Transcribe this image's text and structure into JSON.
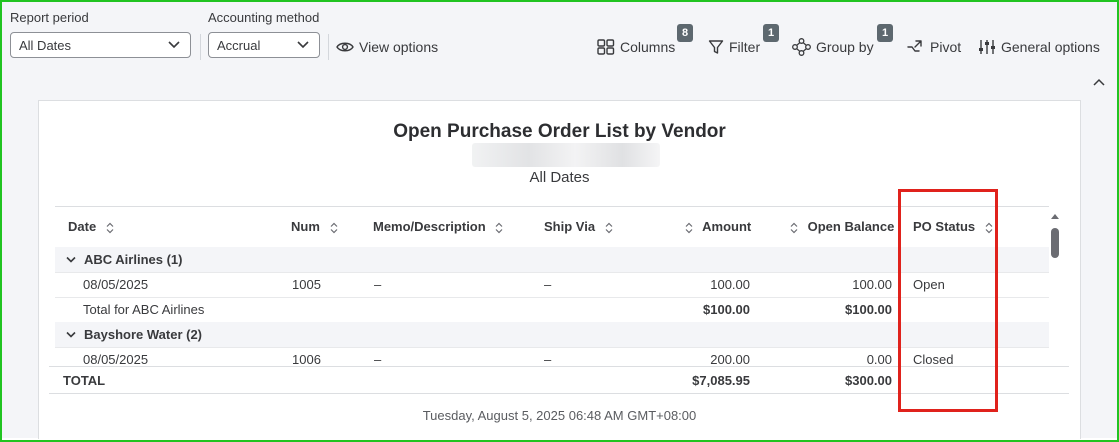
{
  "toolbar": {
    "report_period_label": "Report period",
    "report_period_value": "All Dates",
    "accounting_method_label": "Accounting method",
    "accounting_method_value": "Accrual",
    "view_options": "View options",
    "columns_label": "Columns",
    "columns_count": "8",
    "filter_label": "Filter",
    "filter_count": "1",
    "group_by_label": "Group by",
    "group_by_count": "1",
    "pivot_label": "Pivot",
    "general_options_label": "General options"
  },
  "report": {
    "title": "Open Purchase Order List by Vendor",
    "subtitle": "All Dates",
    "columns": [
      "Date",
      "Num",
      "Memo/Description",
      "Ship Via",
      "Amount",
      "Open Balance",
      "PO Status"
    ],
    "groups": [
      {
        "name": "ABC Airlines (1)",
        "rows": [
          {
            "date": "08/05/2025",
            "num": "1005",
            "memo": "–",
            "ship_via": "–",
            "amount": "100.00",
            "open_balance": "100.00",
            "status": "Open"
          }
        ],
        "total_label": "Total for ABC Airlines",
        "total_amount": "$100.00",
        "total_open_balance": "$100.00"
      },
      {
        "name": "Bayshore Water (2)",
        "rows": [
          {
            "date": "08/05/2025",
            "num": "1006",
            "memo": "–",
            "ship_via": "–",
            "amount": "200.00",
            "open_balance": "0.00",
            "status": "Closed"
          }
        ]
      }
    ],
    "total_label": "TOTAL",
    "total_amount": "$7,085.95",
    "total_open_balance": "$300.00",
    "footer": "Tuesday, August 5, 2025 06:48 AM GMT+08:00"
  },
  "colors": {
    "frame": "#21c421",
    "highlight": "#e0221c",
    "toolbar_bg": "#f4f5f8",
    "badge": "#5d686f"
  }
}
